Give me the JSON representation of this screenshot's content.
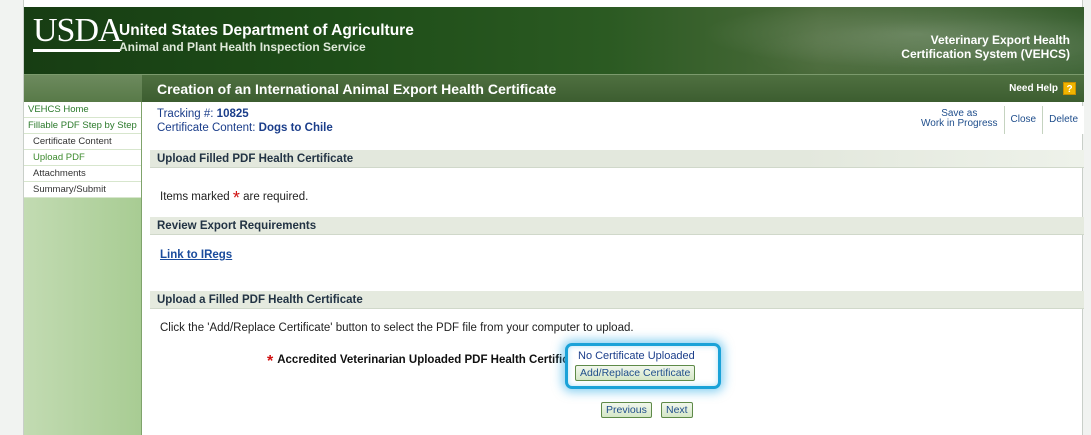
{
  "header": {
    "logo_text": "USDA",
    "agency_name": "United States Department of Agriculture",
    "agency_sub": "Animal and Plant Health Inspection Service",
    "system_line1": "Veterinary Export Health",
    "system_line2": "Certification System (VEHCS)"
  },
  "titlebar": {
    "title": "Creation of an International Animal Export Health Certificate",
    "help_label": "Need Help",
    "help_icon": "?"
  },
  "sidebar": {
    "items": [
      {
        "label": "VEHCS Home"
      },
      {
        "label": "Fillable PDF Step by Step"
      },
      {
        "label": "Certificate Content"
      },
      {
        "label": "Upload PDF"
      },
      {
        "label": "Attachments"
      },
      {
        "label": "Summary/Submit"
      }
    ]
  },
  "main": {
    "tracking_label": "Tracking #:",
    "tracking_value": "10825",
    "content_label": "Certificate Content:",
    "content_value": "Dogs to Chile",
    "actions": {
      "save_line1": "Save as",
      "save_line2": "Work in Progress",
      "close": "Close",
      "delete": "Delete"
    },
    "section_upload_filled": "Upload Filled PDF Health Certificate",
    "required_pre": "Items marked",
    "required_star": "*",
    "required_post": "are required.",
    "section_review": "Review Export Requirements",
    "irregs_link": "Link to IRegs",
    "section_upload_pdf": "Upload a Filled PDF Health Certificate",
    "instructions": "Click the 'Add/Replace Certificate' button to select the PDF file from your computer to upload.",
    "field_star": "*",
    "field_label": "Accredited Veterinarian Uploaded PDF Health Certificate:",
    "no_cert": "No Certificate Uploaded",
    "add_replace": "Add/Replace Certificate",
    "previous": "Previous",
    "next": "Next"
  },
  "colors": {
    "header_green": "#1e4d18",
    "titlebar_green": "#3c5d30",
    "sidebar_green": "#a8cc93",
    "link_blue": "#1a4b9c",
    "required_red": "#d01010",
    "highlight_blue": "#1aa2d8"
  }
}
